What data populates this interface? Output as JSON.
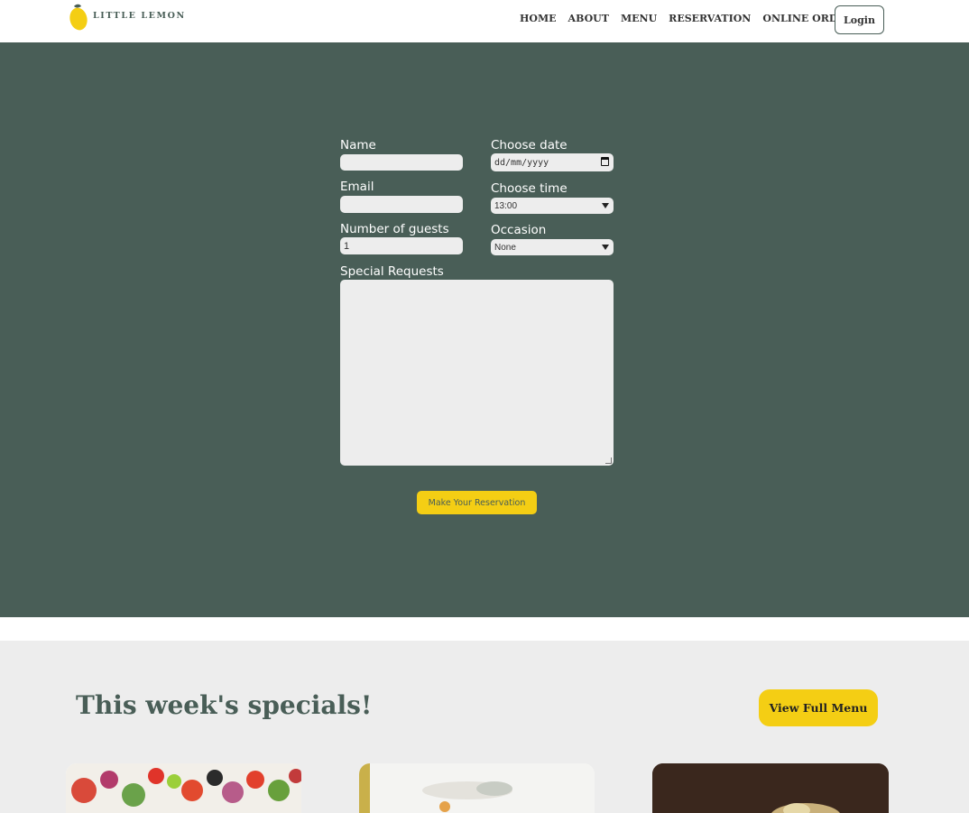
{
  "header": {
    "logo_text": "LITTLE LEMON",
    "nav": [
      "HOME",
      "ABOUT",
      "MENU",
      "RESERVATION",
      "ONLINE ORDER"
    ],
    "login_label": "Login"
  },
  "form": {
    "name_label": "Name",
    "name_value": "",
    "email_label": "Email",
    "email_value": "",
    "guests_label": "Number of guests",
    "guests_value": "1",
    "date_label": "Choose date",
    "date_placeholder": "dd/mm/yyyy",
    "time_label": "Choose time",
    "time_value": "13:00",
    "occasion_label": "Occasion",
    "occasion_value": "None",
    "requests_label": "Special Requests",
    "requests_value": "",
    "submit_label": "Make Your Reservation"
  },
  "specials": {
    "title": "This week's specials!",
    "menu_button": "View Full Menu"
  },
  "colors": {
    "primary_green": "#495e57",
    "primary_yellow": "#f4ce14",
    "light_gray": "#ededed"
  }
}
